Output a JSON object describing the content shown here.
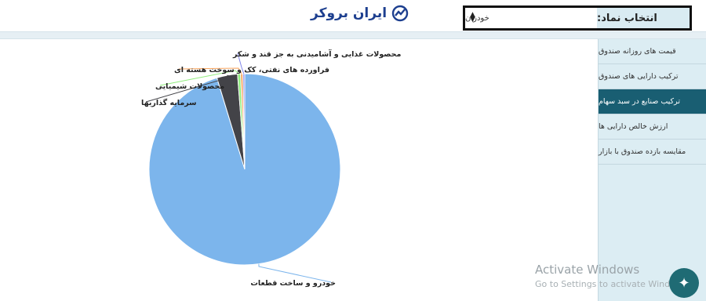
{
  "header": {
    "logo_text": "ایران بروکر",
    "symbol_label": "انتخاب نماد:",
    "symbol_value": "خودران"
  },
  "sidebar": {
    "items": [
      {
        "label": "قیمت های روزانه صندوق",
        "active": false
      },
      {
        "label": "ترکیب دارایی های صندوق",
        "active": false
      },
      {
        "label": "ترکیب صنایع در سبد سهام",
        "active": true
      },
      {
        "label": "ارزش خالص دارایی ها",
        "active": false
      },
      {
        "label": "مقایسه بازده صندوق با بازار",
        "active": false
      }
    ]
  },
  "chart_data": {
    "type": "pie",
    "title": "",
    "slices": [
      {
        "label": "خودرو و ساخت قطعات",
        "value": 95.3,
        "color": "#7cb5ec"
      },
      {
        "label": "سرمایه گذاریها",
        "value": 3.5,
        "color": "#434348"
      },
      {
        "label": "محصولات شیمیایی",
        "value": 0.5,
        "color": "#90ed7d"
      },
      {
        "label": "فراورده های نفتی، کک و سوخت هسته ای",
        "value": 0.4,
        "color": "#f7a35c"
      },
      {
        "label": "محصولات غذایی و آشامیدنی به جز قند و شکر",
        "value": 0.3,
        "color": "#8085e9"
      }
    ]
  },
  "watermark": {
    "line1": "Activate Windows",
    "line2": "Go to Settings to activate Windows."
  },
  "colors": {
    "active": "#195e72",
    "sidebar_bg": "#dcedf3",
    "brand": "#1d3f8f"
  },
  "icons": {
    "fab": "sparkle-icon",
    "logo": "chart-trend-icon",
    "caret": "sort-caret-icon"
  }
}
